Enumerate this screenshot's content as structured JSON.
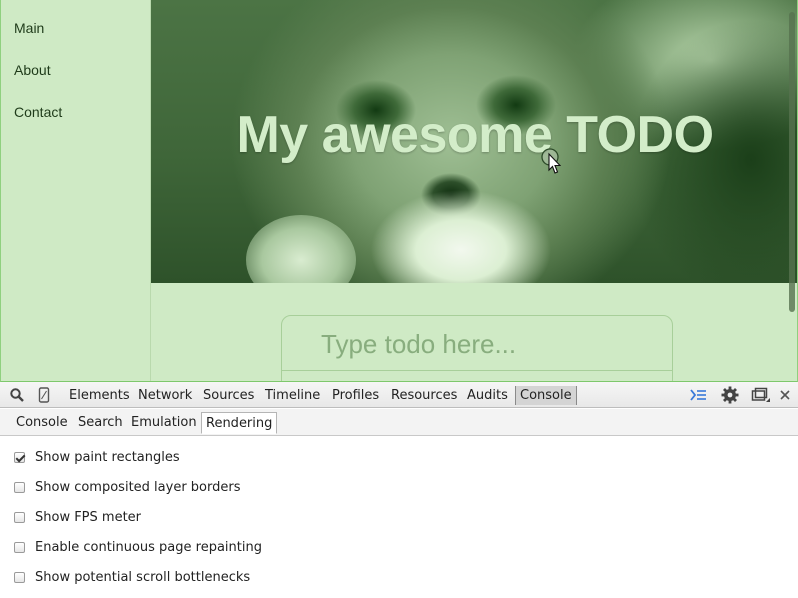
{
  "nav": {
    "items": [
      {
        "label": "Main"
      },
      {
        "label": "About"
      },
      {
        "label": "Contact"
      }
    ]
  },
  "hero": {
    "title": "My awesome TODO"
  },
  "todo": {
    "placeholder": "Type todo here..."
  },
  "devtools": {
    "tabs": [
      {
        "label": "Elements"
      },
      {
        "label": "Network"
      },
      {
        "label": "Sources"
      },
      {
        "label": "Timeline"
      },
      {
        "label": "Profiles"
      },
      {
        "label": "Resources"
      },
      {
        "label": "Audits"
      },
      {
        "label": "Console",
        "selected": true
      }
    ],
    "drawer_tabs": [
      {
        "label": "Console"
      },
      {
        "label": "Search"
      },
      {
        "label": "Emulation"
      },
      {
        "label": "Rendering",
        "selected": true
      }
    ],
    "rendering_options": [
      {
        "label": "Show paint rectangles",
        "checked": true
      },
      {
        "label": "Show composited layer borders",
        "checked": false
      },
      {
        "label": "Show FPS meter",
        "checked": false
      },
      {
        "label": "Enable continuous page repainting",
        "checked": false
      },
      {
        "label": "Show potential scroll bottlenecks",
        "checked": false
      }
    ],
    "icons": {
      "search": "search-icon",
      "device": "device-mode-icon",
      "drawer": "show-drawer-icon",
      "settings": "gear-icon",
      "dock": "dock-side-icon",
      "close": "close-icon"
    },
    "colors": {
      "accent": "#3879d9"
    }
  }
}
